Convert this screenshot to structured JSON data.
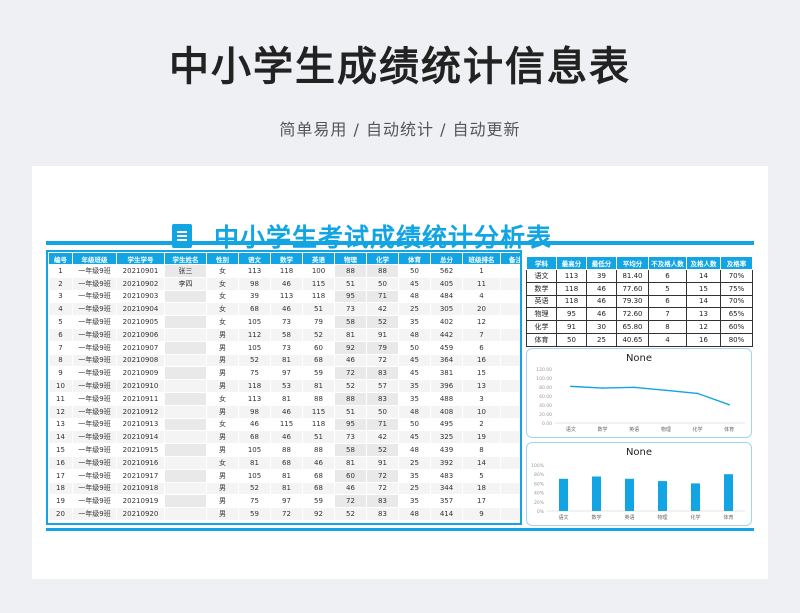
{
  "page": {
    "title": "中小学生成绩统计信息表",
    "subtitle": "简单易用 / 自动统计 / 自动更新"
  },
  "sheet": {
    "title": "中小学生考试成绩统计分析表",
    "columns": [
      "编号",
      "年级班级",
      "学生学号",
      "学生姓名",
      "性别",
      "语文",
      "数学",
      "英语",
      "物理",
      "化学",
      "体育",
      "总分",
      "班级排名",
      "备注"
    ],
    "rows": [
      [
        "1",
        "一年级9班",
        "20210901",
        "张三",
        "女",
        "113",
        "118",
        "100",
        "88",
        "88",
        "50",
        "562",
        "1",
        ""
      ],
      [
        "2",
        "一年级9班",
        "20210902",
        "李四",
        "女",
        "98",
        "46",
        "115",
        "51",
        "50",
        "45",
        "405",
        "11",
        ""
      ],
      [
        "3",
        "一年级9班",
        "20210903",
        "",
        "女",
        "39",
        "113",
        "118",
        "95",
        "71",
        "48",
        "484",
        "4",
        ""
      ],
      [
        "4",
        "一年级9班",
        "20210904",
        "",
        "女",
        "68",
        "46",
        "51",
        "73",
        "42",
        "25",
        "305",
        "20",
        ""
      ],
      [
        "5",
        "一年级9班",
        "20210905",
        "",
        "女",
        "105",
        "73",
        "79",
        "58",
        "52",
        "35",
        "402",
        "12",
        ""
      ],
      [
        "6",
        "一年级9班",
        "20210906",
        "",
        "男",
        "112",
        "58",
        "52",
        "81",
        "91",
        "48",
        "442",
        "7",
        ""
      ],
      [
        "7",
        "一年级9班",
        "20210907",
        "",
        "男",
        "105",
        "73",
        "60",
        "92",
        "79",
        "50",
        "459",
        "6",
        ""
      ],
      [
        "8",
        "一年级9班",
        "20210908",
        "",
        "男",
        "52",
        "81",
        "68",
        "46",
        "72",
        "45",
        "364",
        "16",
        ""
      ],
      [
        "9",
        "一年级9班",
        "20210909",
        "",
        "男",
        "75",
        "97",
        "59",
        "72",
        "83",
        "45",
        "381",
        "15",
        ""
      ],
      [
        "10",
        "一年级9班",
        "20210910",
        "",
        "男",
        "118",
        "53",
        "81",
        "52",
        "57",
        "35",
        "396",
        "13",
        ""
      ],
      [
        "11",
        "一年级9班",
        "20210911",
        "",
        "女",
        "113",
        "81",
        "88",
        "88",
        "83",
        "35",
        "488",
        "3",
        ""
      ],
      [
        "12",
        "一年级9班",
        "20210912",
        "",
        "男",
        "98",
        "46",
        "115",
        "51",
        "50",
        "48",
        "408",
        "10",
        ""
      ],
      [
        "13",
        "一年级9班",
        "20210913",
        "",
        "女",
        "46",
        "115",
        "118",
        "95",
        "71",
        "50",
        "495",
        "2",
        ""
      ],
      [
        "14",
        "一年级9班",
        "20210914",
        "",
        "男",
        "68",
        "46",
        "51",
        "73",
        "42",
        "45",
        "325",
        "19",
        ""
      ],
      [
        "15",
        "一年级9班",
        "20210915",
        "",
        "男",
        "105",
        "88",
        "88",
        "58",
        "52",
        "48",
        "439",
        "8",
        ""
      ],
      [
        "16",
        "一年级9班",
        "20210916",
        "",
        "女",
        "81",
        "68",
        "46",
        "81",
        "91",
        "25",
        "392",
        "14",
        ""
      ],
      [
        "17",
        "一年级9班",
        "20210917",
        "",
        "男",
        "105",
        "81",
        "68",
        "60",
        "72",
        "35",
        "483",
        "5",
        ""
      ],
      [
        "18",
        "一年级9班",
        "20210918",
        "",
        "男",
        "52",
        "81",
        "68",
        "46",
        "72",
        "25",
        "344",
        "18",
        ""
      ],
      [
        "19",
        "一年级9班",
        "20210919",
        "",
        "男",
        "75",
        "97",
        "59",
        "72",
        "83",
        "35",
        "357",
        "17",
        ""
      ],
      [
        "20",
        "一年级9班",
        "20210920",
        "",
        "男",
        "59",
        "72",
        "92",
        "52",
        "83",
        "48",
        "414",
        "9",
        ""
      ]
    ]
  },
  "stats": {
    "columns": [
      "学科",
      "最高分",
      "最低分",
      "平均分",
      "不及格人数",
      "及格人数",
      "及格率"
    ],
    "rows": [
      [
        "语文",
        "113",
        "39",
        "81.40",
        "6",
        "14",
        "70%"
      ],
      [
        "数学",
        "118",
        "46",
        "77.60",
        "5",
        "15",
        "75%"
      ],
      [
        "英语",
        "118",
        "46",
        "79.30",
        "6",
        "14",
        "70%"
      ],
      [
        "物理",
        "95",
        "46",
        "72.60",
        "7",
        "13",
        "65%"
      ],
      [
        "化学",
        "91",
        "30",
        "65.80",
        "8",
        "12",
        "60%"
      ],
      [
        "体育",
        "50",
        "25",
        "40.65",
        "4",
        "16",
        "80%"
      ]
    ]
  },
  "chart_data": [
    {
      "type": "line",
      "title": "None",
      "categories": [
        "语文",
        "数学",
        "英语",
        "物理",
        "化学",
        "体育"
      ],
      "values": [
        81.4,
        77.6,
        79.3,
        72.6,
        65.8,
        40.65
      ],
      "ylim": [
        0,
        120
      ],
      "yticks": [
        "0.00",
        "20.00",
        "40.00",
        "60.00",
        "80.00",
        "100.00",
        "120.00"
      ],
      "color": "#12a4e3"
    },
    {
      "type": "bar",
      "title": "None",
      "categories": [
        "语文",
        "数学",
        "英语",
        "物理",
        "化学",
        "体育"
      ],
      "values": [
        70,
        75,
        70,
        65,
        60,
        80
      ],
      "ylim": [
        0,
        100
      ],
      "yticks": [
        "0%",
        "20%",
        "40%",
        "60%",
        "80%",
        "100%"
      ],
      "color": "#12a4e3"
    }
  ]
}
